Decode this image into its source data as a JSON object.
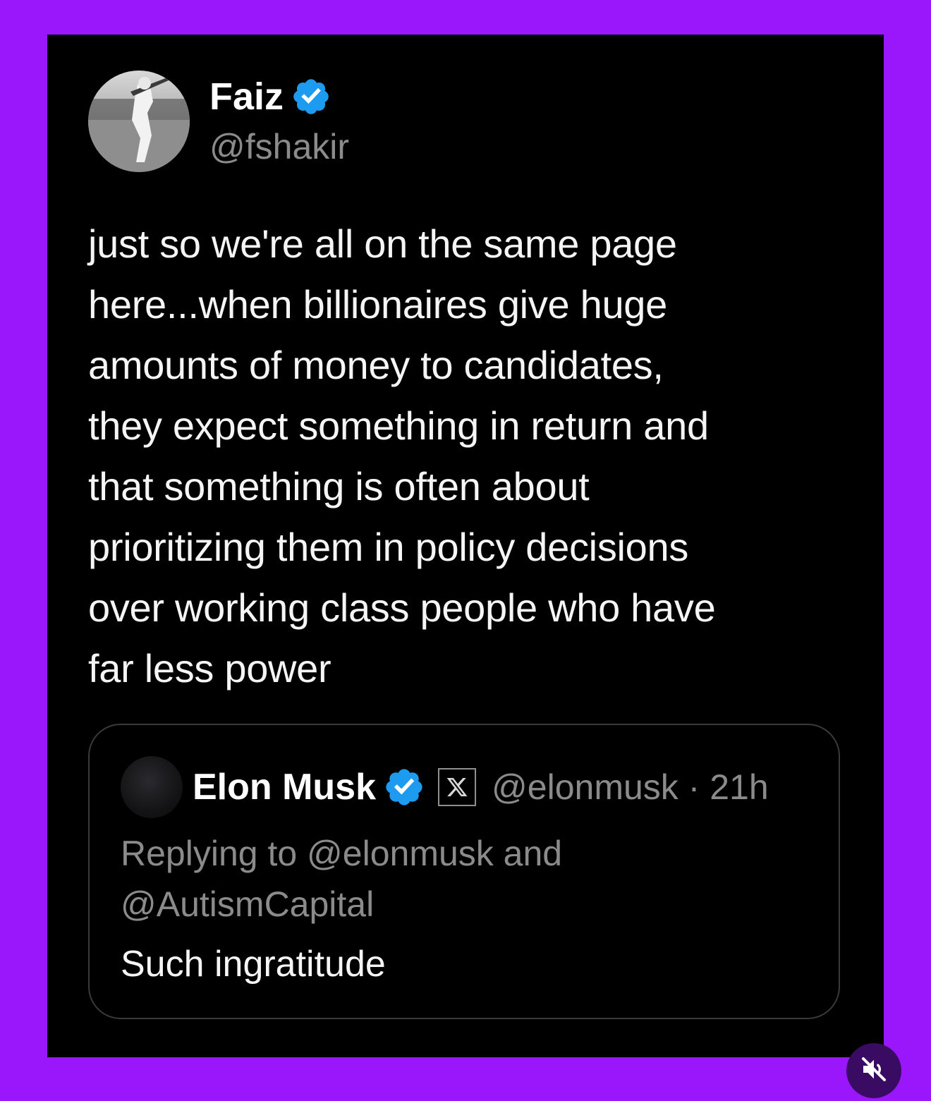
{
  "tweet": {
    "author_name": "Faiz",
    "author_handle": "@fshakir",
    "text": "just so we're all on the same page\nhere...when billionaires give huge\namounts of money to candidates,\nthey expect something in return and\nthat something is often about\nprioritizing them in policy decisions\nover working class people who have\nfar less power"
  },
  "quoted_tweet": {
    "author_name": "Elon Musk",
    "meta": "@elonmusk · 21h",
    "replying_to": "Replying to @elonmusk and\n@AutismCapital",
    "text": "Such ingratitude"
  },
  "colors": {
    "page_background": "#9a17fc",
    "card_background": "#000000",
    "verified_badge": "#1d9bf0",
    "secondary_text": "#8b8b8b"
  },
  "icons": {
    "verified": "verified-badge-icon",
    "x_logo": "x-logo-icon",
    "mute": "speaker-muted-icon"
  }
}
